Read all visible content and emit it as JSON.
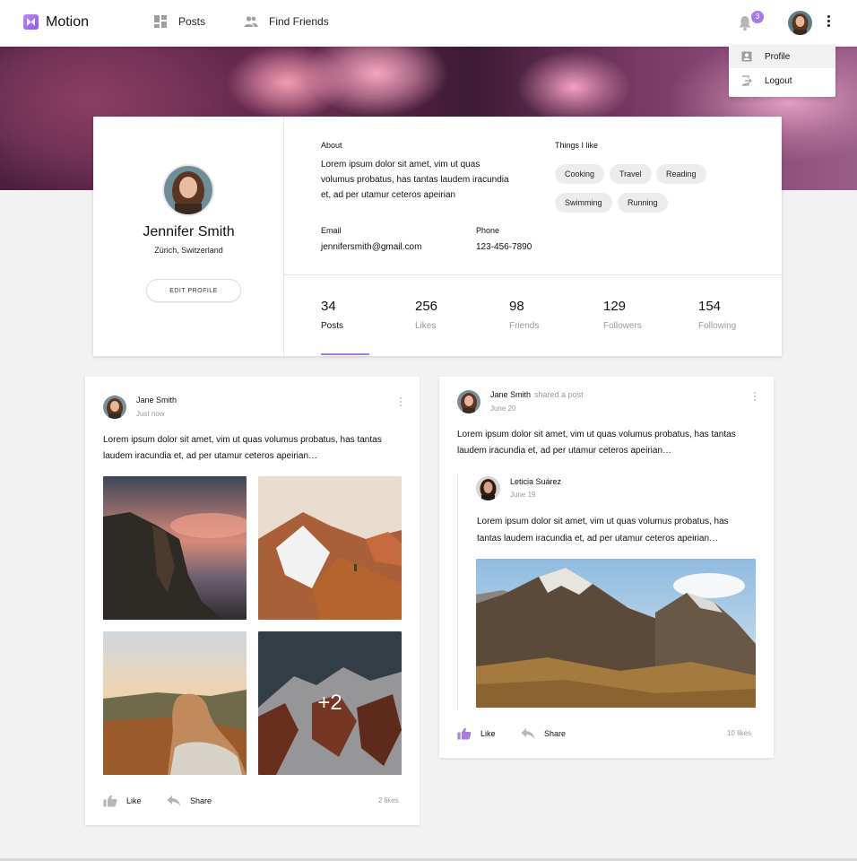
{
  "app": {
    "name": "Motion"
  },
  "nav": {
    "posts_label": "Posts",
    "find_friends_label": "Find Friends",
    "notifications_count": "3"
  },
  "dropdown": {
    "items": [
      {
        "label": "Profile",
        "icon": "person-icon"
      },
      {
        "label": "Logout",
        "icon": "logout-icon"
      }
    ]
  },
  "profile": {
    "name": "Jennifer Smith",
    "location": "Zürich, Switzerland",
    "edit_label": "EDIT PROFILE",
    "about_label": "About",
    "about_text": "Lorem ipsum dolor sit amet, vim ut quas volumus probatus, has tantas laudem iracundia et, ad per utamur ceteros apeirian",
    "things_label": "Things I like",
    "things": [
      "Cooking",
      "Travel",
      "Reading",
      "Swimming",
      "Running"
    ],
    "email_label": "Email",
    "email": "jennifersmith@gmail.com",
    "phone_label": "Phone",
    "phone": "123-456-7890",
    "stats": [
      {
        "value": "34",
        "label": "Posts"
      },
      {
        "value": "256",
        "label": "Likes"
      },
      {
        "value": "98",
        "label": "Friends"
      },
      {
        "value": "129",
        "label": "Followers"
      },
      {
        "value": "154",
        "label": "Following"
      }
    ]
  },
  "posts": [
    {
      "author": "Jane Smith",
      "date": "Just now",
      "text_line1": "Lorem ipsum dolor sit amet, vim ut quas volumus probatus, has tantas",
      "text_line2": "laudem iracundia et, ad per utamur ceteros apeirian…",
      "more_photos": "+2",
      "like_label": "Like",
      "share_label": "Share",
      "likes": "2 likes"
    },
    {
      "author": "Jane Smith",
      "action": "shared a post",
      "date": "June 20",
      "text_line1": "Lorem ipsum dolor sit amet, vim ut quas volumus probatus, has tantas",
      "text_line2": "laudem iracundia et, ad per utamur ceteros apeirian…",
      "shared": {
        "author": "Leticia Suárez",
        "date": "June 19",
        "text_line1": "Lorem ipsum dolor sit amet, vim ut quas volumus probatus, has",
        "text_line2": "tantas laudem iracundia et, ad per utamur ceteros apeirian…"
      },
      "like_label": "Like",
      "share_label": "Share",
      "likes": "10 likes"
    }
  ],
  "colors": {
    "accent": "#a67be8",
    "background": "#f2f2f2"
  }
}
